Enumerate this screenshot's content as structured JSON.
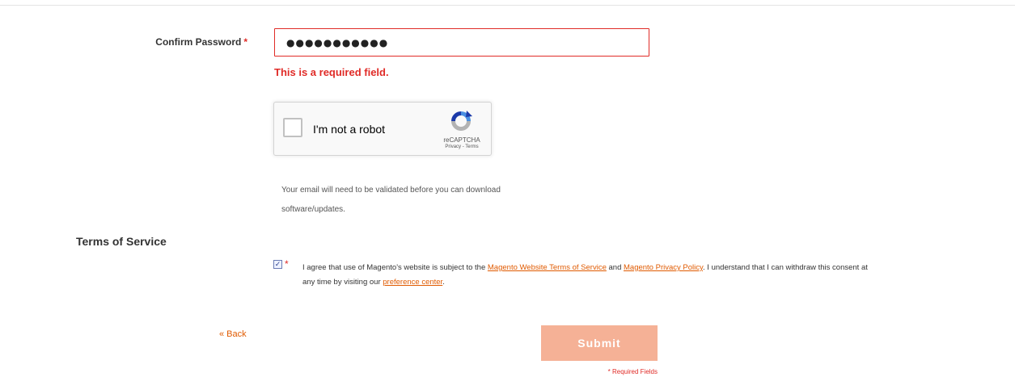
{
  "confirm_password": {
    "label": "Confirm Password",
    "required_mark": "*",
    "value": "●●●●●●●●●●●",
    "error": "This is a required field."
  },
  "recaptcha": {
    "label": "I'm not a robot",
    "brand": "reCAPTCHA",
    "links": "Privacy - Terms",
    "checked": false
  },
  "note": {
    "text": "Your email will need to be validated before you can download software/updates."
  },
  "terms": {
    "title": "Terms of Service",
    "checked": true,
    "required_mark": "*",
    "text_1": "I agree that use of Magento's website is subject to the ",
    "link_terms": "Magento Website Terms of Service",
    "text_2": " and ",
    "link_privacy": "Magento Privacy Policy",
    "text_3": ". I understand that I can withdraw this consent at any time by visiting our ",
    "link_preference": "preference center",
    "text_4": "."
  },
  "actions": {
    "back_label": "« Back",
    "submit_label": "Submit",
    "required_fields": "* Required Fields"
  },
  "colors": {
    "error": "#e02b27",
    "link": "#e05a00",
    "submit_bg": "#f5b196",
    "recaptcha_blue": "#4a90e2",
    "recaptcha_grey": "#b3b3b3"
  },
  "icons": {
    "recaptcha_logo": "recaptcha-logo-icon",
    "checkbox_check": "check-icon"
  }
}
